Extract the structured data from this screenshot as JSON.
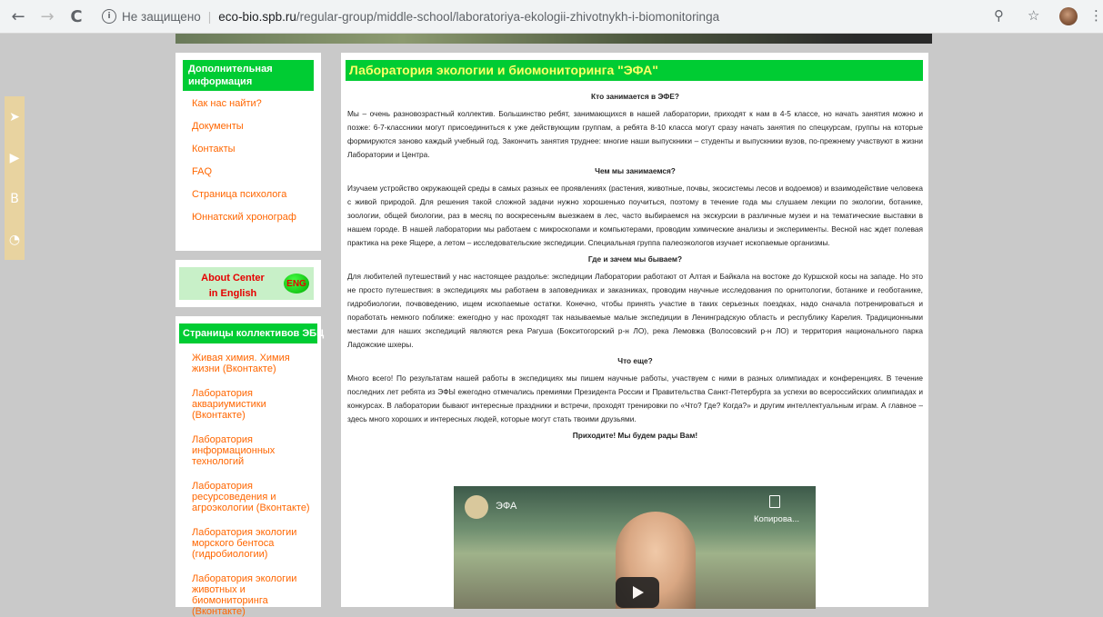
{
  "browser": {
    "back": "←",
    "forward": "→",
    "reload": "C",
    "security_label": "Не защищено",
    "url_host": "eco-bio.spb.ru",
    "url_path": "/regular-group/middle-school/laboratoriya-ekologii-zhivotnykh-i-biomonitoringa",
    "zoom_icon": "⚲",
    "star_icon": "☆",
    "menu_icon": "⋮"
  },
  "side_tabs": [
    "➤",
    "▶",
    "B",
    "◔"
  ],
  "sidebar": {
    "box1_title": "Дополнительная информация",
    "box1_links": [
      "Как нас найти?",
      "Документы",
      "Контакты",
      "FAQ",
      "Страница психолога",
      "Юннатский хронограф"
    ],
    "about_center_line1": "About Center",
    "about_center_line2": "in English",
    "eng_badge": "ENG",
    "box3_title": "Страницы коллективов ЭБЦ",
    "box3_links": [
      "Живая химия. Химия жизни (Вконтакте)",
      "Лаборатория аквариумистики (Вконтакте)",
      "Лаборатория информационных технологий",
      "Лаборатория ресурсоведения и агроэкологии (Вконтакте)",
      "Лаборатория экологии морского бентоса (гидробиологии)",
      "Лаборатория экологии животных и биомониторинга (Вконтакте)"
    ]
  },
  "main": {
    "title": "Лаборатория экологии и биомониторинга \"ЭФА\"",
    "h1": "Кто занимается в ЭФЕ?",
    "p1": "Мы – очень разновозрастный коллектив. Большинство ребят, занимающихся в нашей лаборатории, приходят к нам в 4-5 классе, но начать занятия можно и позже: 6-7-классники могут присоединиться к уже действующим группам, а ребята 8-10 класса могут сразу начать занятия по спецкурсам, группы на которые формируются заново каждый учебный год. Закончить занятия труднее: многие наши выпускники – студенты и выпускники вузов, по-прежнему участвуют в жизни Лаборатории и Центра.",
    "h2": "Чем мы занимаемся?",
    "p2": "Изучаем устройство окружающей среды в самых разных ее проявлениях (растения, животные, почвы, экосистемы лесов и водоемов) и взаимодействие человека с живой природой. Для решения такой сложной задачи нужно хорошенько поучиться, поэтому в течение года мы слушаем лекции по экологии, ботанике, зоологии, общей биологии, раз в месяц по воскресеньям выезжаем в лес, часто выбираемся на экскурсии в различные музеи и на тематические выставки в нашем городе. В нашей лаборатории мы работаем с микроскопами и компьютерами, проводим химические анализы и эксперименты. Весной нас ждет полевая практика на реке Ящере, а летом – исследовательские экспедиции. Специальная группа палеоэкологов изучает ископаемые организмы.",
    "h3": "Где и зачем мы бываем?",
    "p3": "Для любителей путешествий у нас настоящее раздолье: экспедиции Лаборатории работают от Алтая и Байкала на востоке до Куршской косы на западе. Но это не просто путешествия: в экспедициях мы работаем в заповедниках и заказниках, проводим научные исследования по орнитологии, ботанике и геоботанике, гидробиологии, почвоведению, ищем ископаемые остатки. Конечно, чтобы принять участие в таких серьезных поездках, надо сначала потренироваться и поработать немного поближе: ежегодно у нас проходят так называемые малые экспедиции в Ленинградскую область и республику Карелия. Традиционными местами для наших экспедиций являются река Рагуша (Бокситогорский р-н ЛО), река Лемовжа (Волосовский р-н ЛО) и территория национального парка Ладожские шхеры.",
    "h4": "Что еще?",
    "p4": "Много всего! По результатам нашей работы в экспедициях мы пишем научные работы, участвуем с ними в разных олимпиадах и конференциях. В течение последних лет ребята из ЭФЫ ежегодно отмечались премиями Президента России и Правительства Санкт-Петербурга за успехи во всероссийских олимпиадах и конкурсах. В лаборатории бывают интересные праздники и встречи, проходят тренировки по «Что? Где? Когда?» и другим интеллектуальным играм. А главное – здесь много хороших и интересных людей, которые могут стать твоими друзьями.",
    "closing": "Приходите! Мы будем рады Вам!"
  },
  "video": {
    "title": "ЭФА",
    "copy_label": "Копирова..."
  }
}
